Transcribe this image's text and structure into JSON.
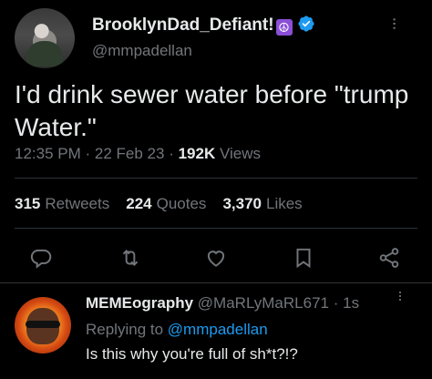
{
  "tweet": {
    "display_name": "BrooklynDad_Defiant!",
    "peace_symbol": "☮",
    "handle": "@mmpadellan",
    "more": "···",
    "text": "I'd drink sewer water before \"trump Water.\"",
    "time": "12:35 PM",
    "date": "22 Feb 23",
    "views_count": "192K",
    "views_label": "Views"
  },
  "stats": {
    "retweets_count": "315",
    "retweets_label": "Retweets",
    "quotes_count": "224",
    "quotes_label": "Quotes",
    "likes_count": "3,370",
    "likes_label": "Likes"
  },
  "reply": {
    "display_name": "MEMEography",
    "handle": "@MaRLyMaRL671",
    "age": "1s",
    "more": "···",
    "replying_to_label": "Replying to",
    "replying_to_handle": "@mmpadellan",
    "text": "Is this why you're full of sh*t?!?"
  },
  "colors": {
    "background": "#000000",
    "text": "#e7e9ea",
    "muted": "#71767b",
    "link": "#1d9bf0",
    "verified": "#1d9bf0",
    "divider": "#2f3336"
  },
  "icons": [
    "verified-badge-icon",
    "reply-icon",
    "retweet-icon",
    "like-icon",
    "bookmark-icon",
    "share-icon"
  ]
}
